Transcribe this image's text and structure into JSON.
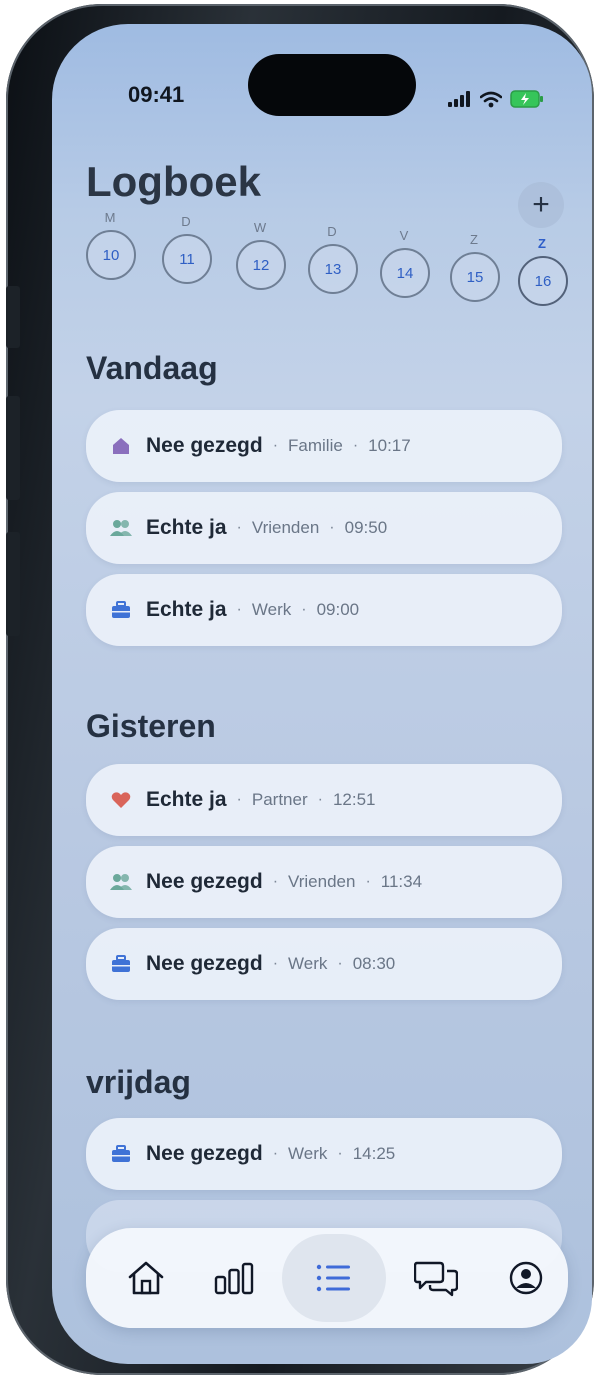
{
  "status": {
    "time": "09:41"
  },
  "header": {
    "title": "Logboek",
    "add_label": "+"
  },
  "week": {
    "days": [
      {
        "letter": "M",
        "date": "10"
      },
      {
        "letter": "D",
        "date": "11"
      },
      {
        "letter": "W",
        "date": "12"
      },
      {
        "letter": "D",
        "date": "13"
      },
      {
        "letter": "V",
        "date": "14"
      },
      {
        "letter": "Z",
        "date": "15"
      },
      {
        "letter": "Z",
        "date": "16",
        "selected": true
      }
    ]
  },
  "sections": [
    {
      "title": "Vandaag",
      "entries": [
        {
          "icon": "home-icon",
          "answer": "Nee gezegd",
          "category": "Familie",
          "time": "10:17"
        },
        {
          "icon": "people-icon",
          "answer": "Echte ja",
          "category": "Vrienden",
          "time": "09:50"
        },
        {
          "icon": "briefcase-icon",
          "answer": "Echte ja",
          "category": "Werk",
          "time": "09:00"
        }
      ]
    },
    {
      "title": "Gisteren",
      "entries": [
        {
          "icon": "heart-icon",
          "answer": "Echte ja",
          "category": "Partner",
          "time": "12:51"
        },
        {
          "icon": "people-icon",
          "answer": "Nee gezegd",
          "category": "Vrienden",
          "time": "11:34"
        },
        {
          "icon": "briefcase-icon",
          "answer": "Nee gezegd",
          "category": "Werk",
          "time": "08:30"
        }
      ]
    },
    {
      "title": "vrijdag",
      "entries": [
        {
          "icon": "briefcase-icon",
          "answer": "Nee gezegd",
          "category": "Werk",
          "time": "14:25"
        }
      ]
    }
  ],
  "nav": {
    "items": [
      "home-icon",
      "stats-icon",
      "list-icon",
      "chat-icon",
      "profile-icon"
    ],
    "active": "list-icon"
  },
  "colors": {
    "accent": "#2e5ec9",
    "home": "#8a6fbd",
    "people": "#6aa89b",
    "briefcase": "#3f72d6",
    "heart": "#d9645a"
  }
}
